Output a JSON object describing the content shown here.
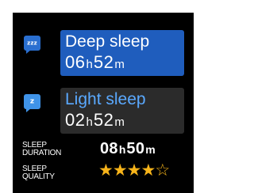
{
  "colors": {
    "deep_accent": "#1f5dbd",
    "light_accent": "#5aa9ff",
    "star": "#f7b41a",
    "background": "#000000"
  },
  "deep_sleep": {
    "icon": "zzz-chat-bubble-icon",
    "icon_text": "zzz",
    "title": "Deep sleep",
    "hours": "06",
    "hours_unit": "h",
    "minutes": "52",
    "minutes_unit": "m"
  },
  "light_sleep": {
    "icon": "z-chat-bubble-icon",
    "icon_text": "z",
    "title": "Light sleep",
    "hours": "02",
    "hours_unit": "h",
    "minutes": "52",
    "minutes_unit": "m"
  },
  "summary": {
    "duration_label_line1": "SLEEP",
    "duration_label_line2": "DURATION",
    "duration_hours": "08",
    "duration_hours_unit": "h",
    "duration_minutes": "50",
    "duration_minutes_unit": "m",
    "quality_label_line1": "SLEEP",
    "quality_label_line2": "QUALITY",
    "quality_rating": 4,
    "quality_max": 5
  }
}
